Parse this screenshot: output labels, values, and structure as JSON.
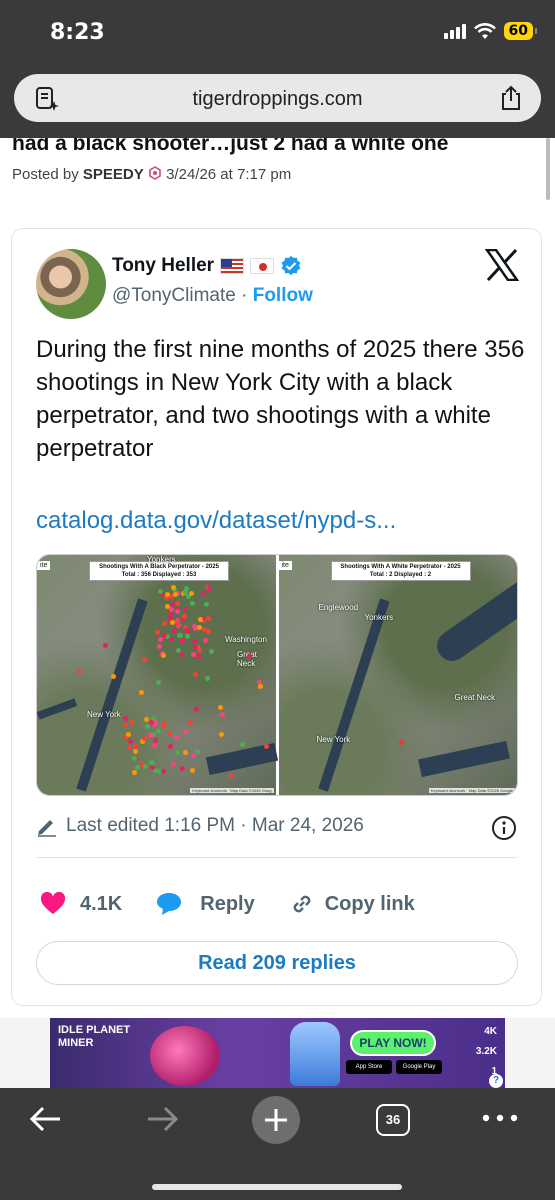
{
  "status_bar": {
    "time": "8:23",
    "battery": "60"
  },
  "browser": {
    "url": "tigerdroppings.com"
  },
  "post": {
    "headline_partial": "had a black shooter…just 2 had a white one",
    "posted_by_label": "Posted by",
    "author": "SPEEDY",
    "timestamp": "3/24/26 at 7:17 pm"
  },
  "tweet": {
    "author_name": "Tony Heller",
    "handle": "@TonyClimate",
    "separator": "·",
    "follow_label": "Follow",
    "text": "During the first nine months of 2025 there 356 shootings in New York City with a black perpetrator, and two shootings with a white perpetrator",
    "link": "catalog.data.gov/dataset/nypd-s...",
    "maps": [
      {
        "corner": "ite",
        "title_line1": "Shootings With A Black Perpetrator - 2025",
        "title_line2": "Total : 356 Displayed : 353",
        "labels": [
          "Yonkers",
          "New York",
          "Great Neck",
          "Washington"
        ],
        "footer": "Keyboard shortcuts · Map Data ©2026 Goog"
      },
      {
        "corner": "ite",
        "title_line1": "Shootings With A White Perpetrator - 2025",
        "title_line2": "Total : 2 Displayed : 2",
        "labels": [
          "Yonkers",
          "New York",
          "Great Neck",
          "Englewood"
        ],
        "footer": "Keyboard shortcuts · Map Data ©2026 Google"
      }
    ],
    "edited_text": "Last edited 1:16 PM · Mar 24, 2026",
    "likes": "4.1K",
    "reply_label": "Reply",
    "copy_link_label": "Copy link",
    "read_replies": "Read 209 replies"
  },
  "ad": {
    "title": "IDLE PLANET MINER",
    "cta": "PLAY NOW!",
    "store1": "App Store",
    "store2": "Google Play",
    "stat1": "4K",
    "stat2": "3.2K",
    "stat3": "1"
  },
  "bottom_bar": {
    "tab_count": "36"
  },
  "colors": {
    "accent": "#1d9bf0",
    "like": "#f91880",
    "chrome": "#3a3a3c"
  }
}
